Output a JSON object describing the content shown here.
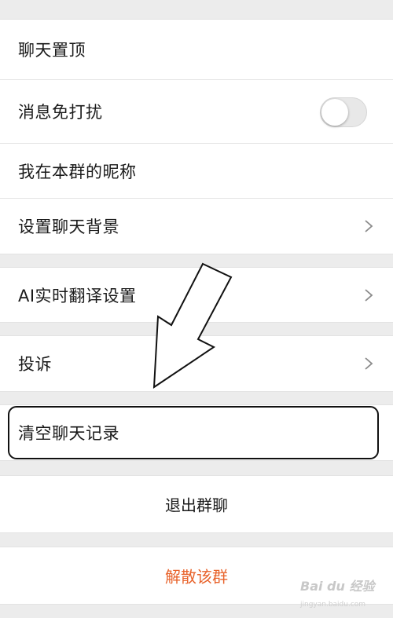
{
  "settings": {
    "pin_chat": "聊天置顶",
    "mute_notifications": "消息免打扰",
    "mute_toggle_state": "off",
    "my_group_nickname": "我在本群的昵称",
    "set_chat_background": "设置聊天背景",
    "ai_translate_settings": "AI实时翻译设置",
    "report": "投诉",
    "clear_chat_history": "清空聊天记录",
    "leave_group": "退出群聊",
    "dissolve_group": "解散该群"
  },
  "colors": {
    "danger": "#e8632b",
    "background": "#ececec"
  },
  "watermark": {
    "text": "Bai du 经验",
    "sub": "jingyan.baidu.com"
  }
}
